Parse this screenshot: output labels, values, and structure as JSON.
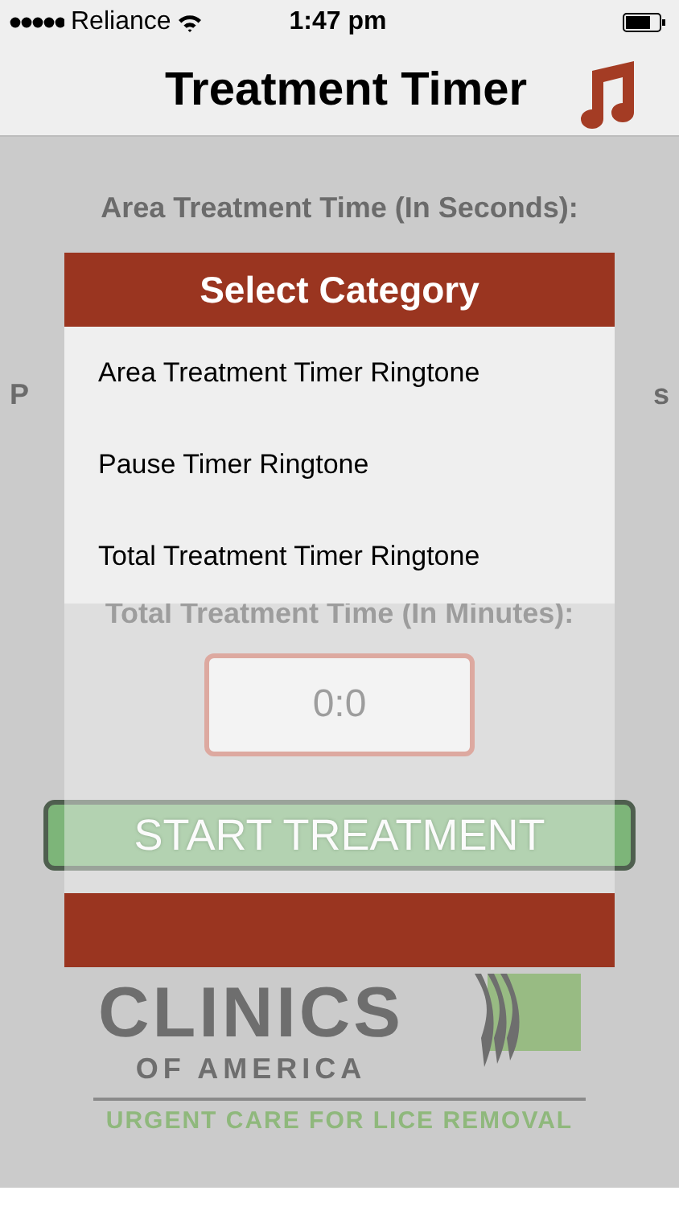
{
  "status_bar": {
    "carrier": "Reliance",
    "time": "1:47 pm"
  },
  "nav_bar": {
    "title": "Treatment Timer"
  },
  "form": {
    "area_label": "Area Treatment Time (In Seconds):",
    "hidden_label_fragments": [
      "P",
      "s"
    ],
    "total_label": "Total Treatment Time (In Minutes):",
    "total_value": "0:0",
    "start_button": "START TREATMENT"
  },
  "logo": {
    "name": "CLINICS",
    "subname": "OF AMERICA",
    "tagline": "URGENT CARE FOR LICE REMOVAL"
  },
  "dialog": {
    "title": "Select Category",
    "items": [
      {
        "label": "Area Treatment Timer Ringtone"
      },
      {
        "label": "Pause Timer Ringtone"
      },
      {
        "label": "Total Treatment Timer Ringtone"
      }
    ]
  }
}
